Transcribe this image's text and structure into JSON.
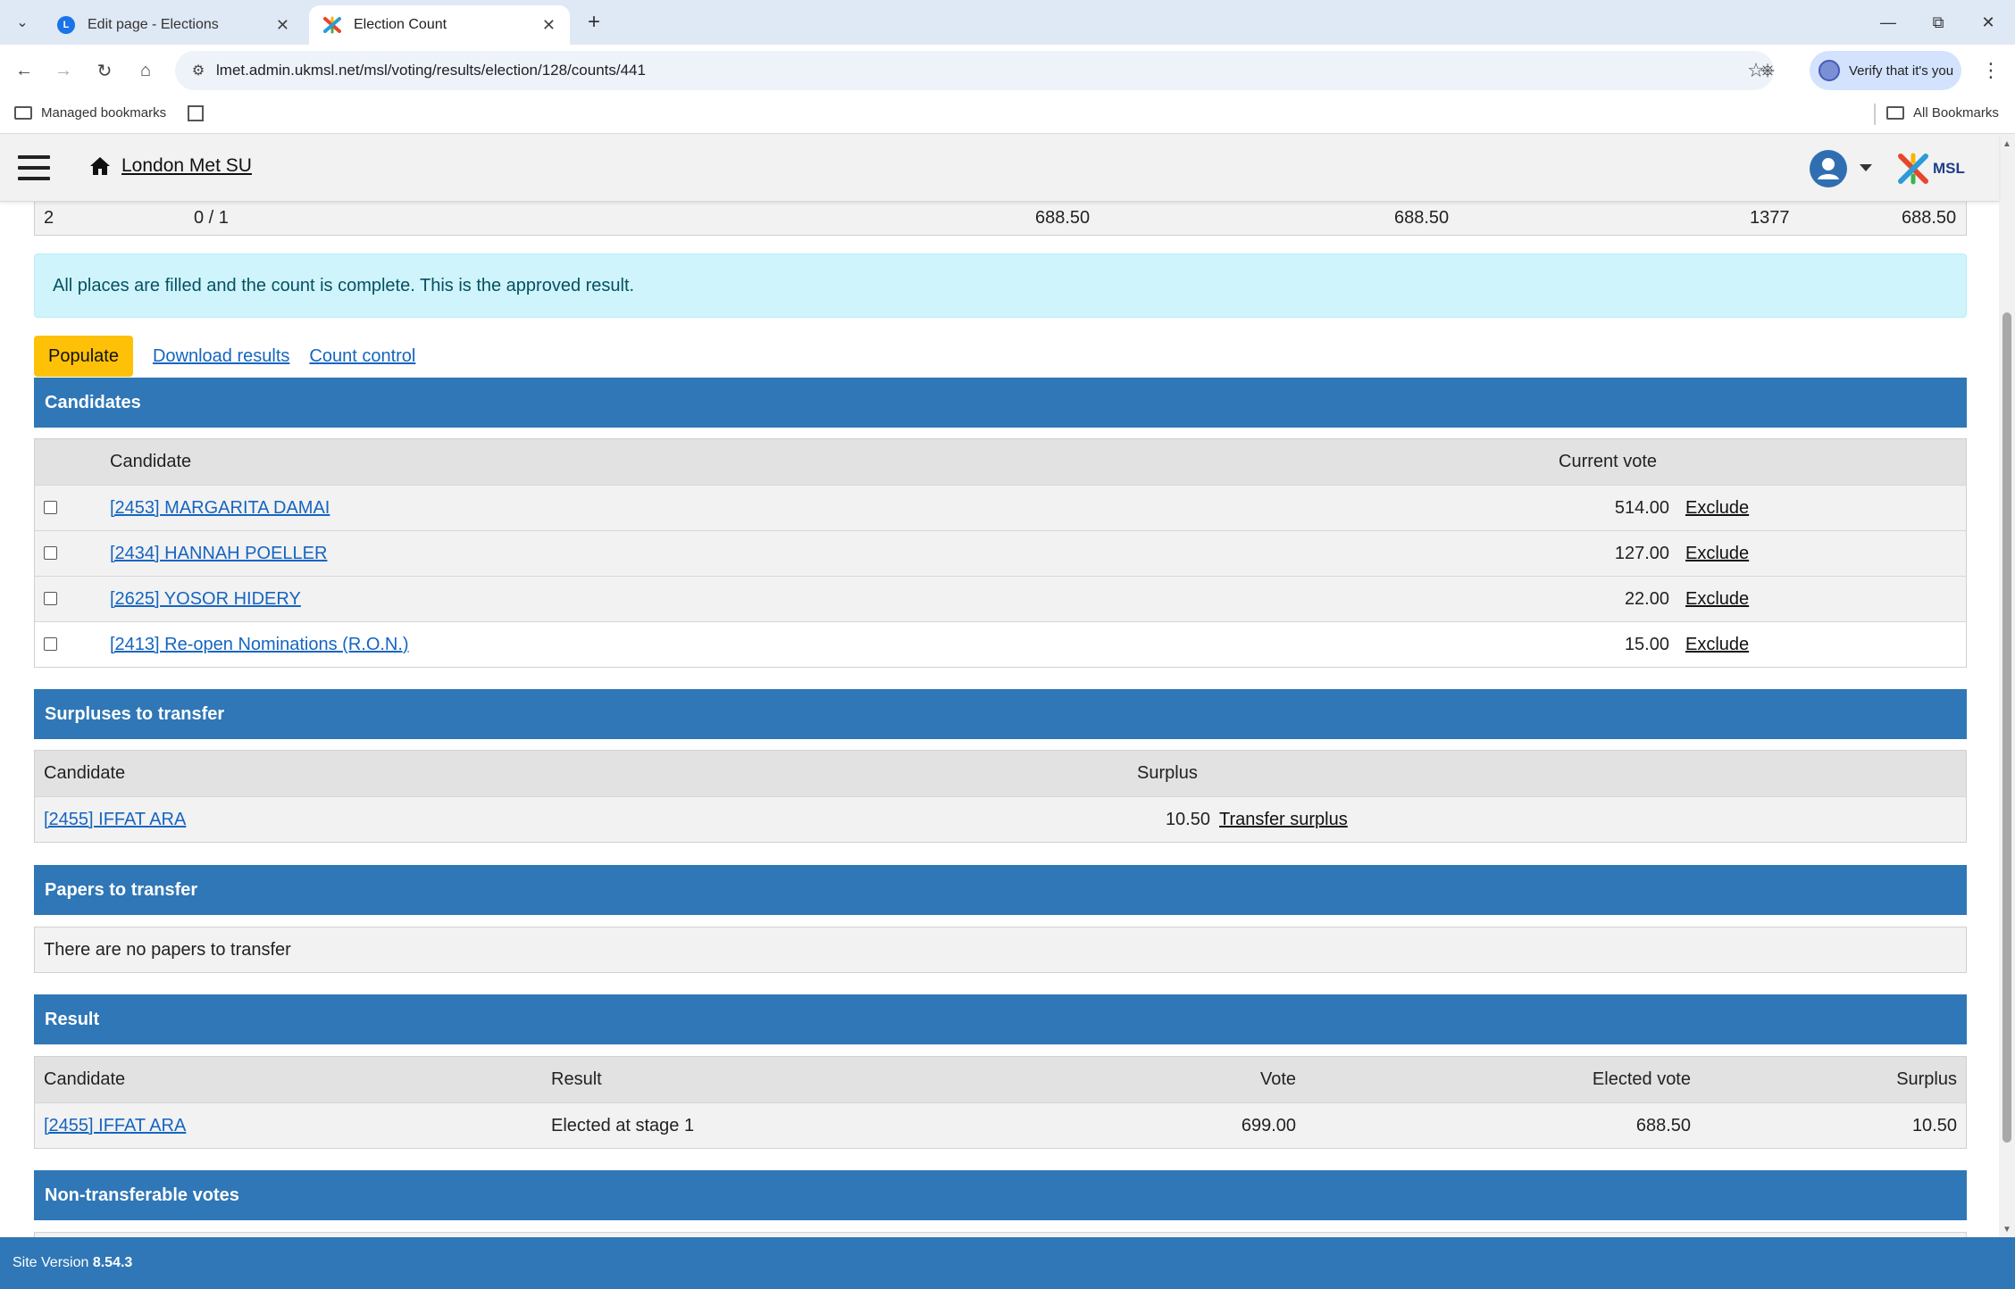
{
  "browser": {
    "tabs": [
      {
        "title": "Edit page - Elections",
        "favicon": "L"
      },
      {
        "title": "Election Count",
        "favicon": "msl-icon"
      }
    ],
    "url": "lmet.admin.ukmsl.net/msl/voting/results/election/128/counts/441",
    "verify_label": "Verify that it's you",
    "bookmarks": {
      "managed": "Managed bookmarks",
      "all": "All Bookmarks"
    }
  },
  "site": {
    "home_label": "London Met SU",
    "logo_text": "MSL"
  },
  "stage_row": {
    "stage": "2",
    "elected": "0 / 1",
    "col3": "688.50",
    "col4": "688.50",
    "col5": "1377",
    "col6": "688.50"
  },
  "alert": "All places are filled and the count is complete. This is the approved result.",
  "actions": {
    "populate": "Populate",
    "download": "Download results",
    "count_control": "Count control"
  },
  "candidates": {
    "title": "Candidates",
    "headers": {
      "candidate": "Candidate",
      "current_vote": "Current vote"
    },
    "rows": [
      {
        "name": "[2453] MARGARITA DAMAI",
        "vote": "514.00",
        "action": "Exclude"
      },
      {
        "name": "[2434] HANNAH POELLER",
        "vote": "127.00",
        "action": "Exclude"
      },
      {
        "name": "[2625] YOSOR HIDERY",
        "vote": "22.00",
        "action": "Exclude"
      },
      {
        "name": "[2413] Re-open Nominations (R.O.N.)",
        "vote": "15.00",
        "action": "Exclude"
      }
    ]
  },
  "surpluses": {
    "title": "Surpluses to transfer",
    "headers": {
      "candidate": "Candidate",
      "surplus": "Surplus"
    },
    "rows": [
      {
        "name": "[2455] IFFAT ARA",
        "surplus": "10.50",
        "action": "Transfer surplus"
      }
    ]
  },
  "papers": {
    "title": "Papers to transfer",
    "message": "There are no papers to transfer"
  },
  "result": {
    "title": "Result",
    "headers": {
      "candidate": "Candidate",
      "result": "Result",
      "vote": "Vote",
      "elected_vote": "Elected vote",
      "surplus": "Surplus"
    },
    "rows": [
      {
        "name": "[2455] IFFAT ARA",
        "result": "Elected at stage 1",
        "vote": "699.00",
        "elected_vote": "688.50",
        "surplus": "10.50"
      }
    ]
  },
  "non_transferable": {
    "title": "Non-transferable votes"
  },
  "footer": {
    "label": "Site Version",
    "version": "8.54.3"
  }
}
